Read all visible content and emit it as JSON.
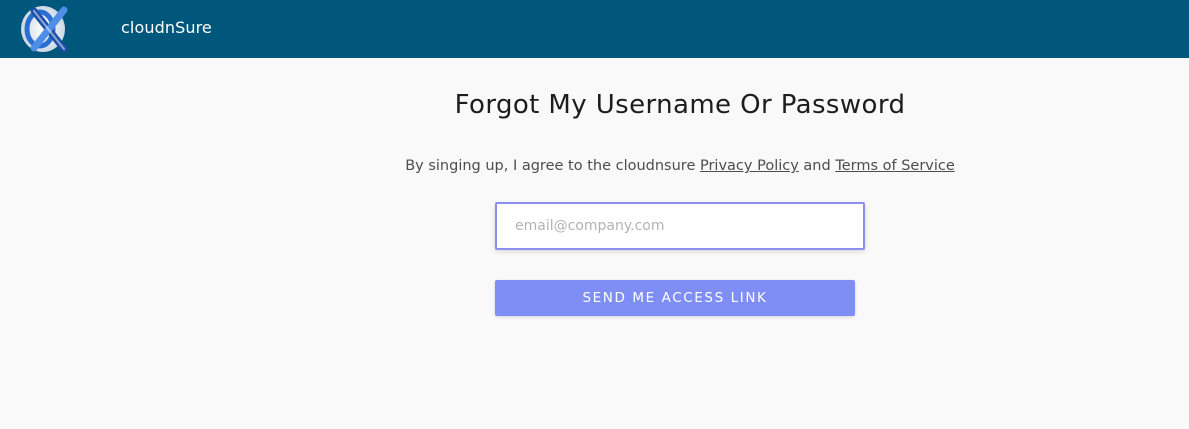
{
  "header": {
    "brand": "cloudnSure",
    "logo_icon": "cloudnsure-logo-icon",
    "background_color": "#00577c"
  },
  "main": {
    "title": "Forgot My Username Or Password",
    "terms": {
      "prefix": "By singing up, I agree to the cloudnsure ",
      "privacy_link": "Privacy Policy",
      "conjunction": " and ",
      "tos_link": "Terms of Service"
    },
    "email_input": {
      "value": "",
      "placeholder": "email@company.com"
    },
    "submit_label": "SEND ME ACCESS LINK",
    "accent_color": "#7f8ef5"
  }
}
